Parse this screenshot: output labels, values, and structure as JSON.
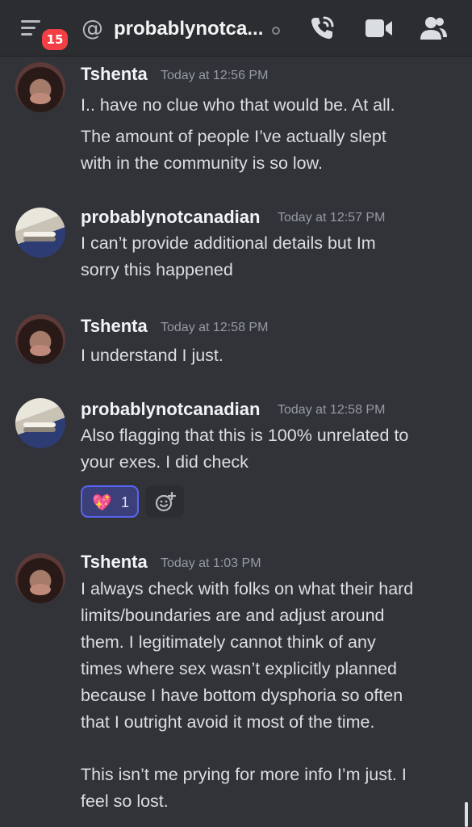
{
  "header": {
    "badge_count": "15",
    "at_symbol": "@",
    "title": "probablynotca...",
    "icons": [
      "menu-icon",
      "call-icon",
      "video-icon",
      "members-icon"
    ],
    "badge_color": "#f23f43"
  },
  "messages": [
    {
      "author": "Tshenta",
      "timestamp": "Today at 12:56 PM",
      "lines": [
        "I.. have no clue who that would be. At all.",
        "The amount of people I’ve actually slept",
        "with in the community is so low."
      ]
    },
    {
      "author": "probablynotcanadian",
      "timestamp": "Today at 12:57 PM",
      "lines": [
        "I can’t provide additional details but Im",
        "sorry this happened"
      ]
    },
    {
      "author": "Tshenta",
      "timestamp": "Today at 12:58 PM",
      "lines": [
        "I understand I just."
      ]
    },
    {
      "author": "probablynotcanadian",
      "timestamp": "Today at 12:58 PM",
      "lines": [
        "Also flagging that this is 100% unrelated to",
        "your exes. I did check"
      ],
      "reaction": {
        "emoji": "💖",
        "count": "1"
      }
    },
    {
      "author": "Tshenta",
      "timestamp": "Today at 1:03 PM",
      "lines": [
        "I always check with folks on what their hard",
        "limits/boundaries are and adjust around",
        "them. I legitimately cannot think of any",
        "times where sex wasn’t explicitly planned",
        "because I have bottom dysphoria so often",
        "that I outright avoid it most of the time.",
        "This isn’t me prying for more info I’m just. I",
        "feel so lost."
      ]
    }
  ],
  "colors": {
    "background": "#313338",
    "header": "#2b2d31",
    "reaction_bg": "#3b3f7a",
    "reaction_border": "#5865f2"
  }
}
